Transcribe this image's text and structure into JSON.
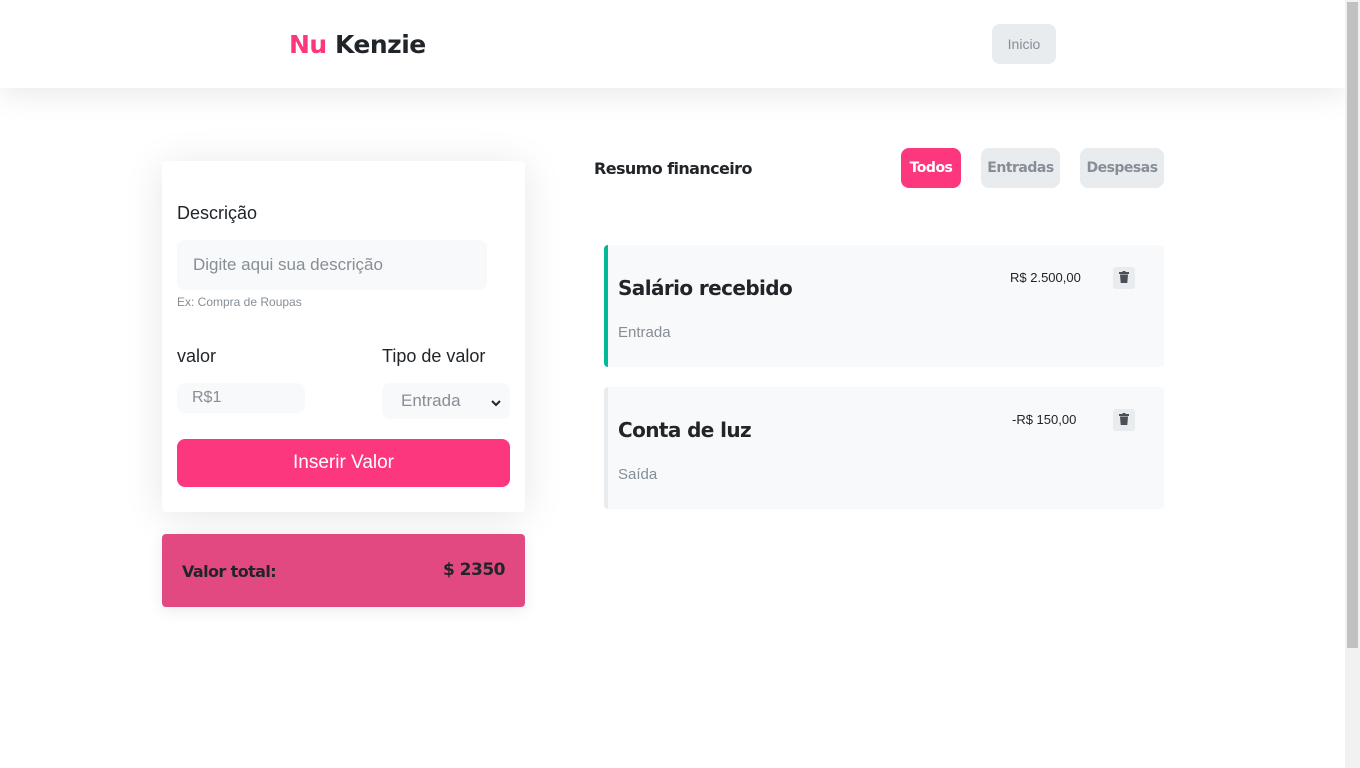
{
  "header": {
    "logo_part1": "Nu",
    "logo_part2": "Kenzie",
    "home_button": "Inicio"
  },
  "form": {
    "description_label": "Descrição",
    "description_placeholder": "Digite aqui sua descrição",
    "description_hint": "Ex: Compra de Roupas",
    "value_label": "valor",
    "value_placeholder": "R$1",
    "type_label": "Tipo de valor",
    "type_selected": "Entrada",
    "submit_label": "Inserir Valor"
  },
  "total": {
    "label": "Valor total:",
    "value": "$ 2350"
  },
  "summary": {
    "title": "Resumo financeiro",
    "filters": [
      {
        "label": "Todos",
        "active": true
      },
      {
        "label": "Entradas",
        "active": false
      },
      {
        "label": "Despesas",
        "active": false
      }
    ]
  },
  "entries": [
    {
      "title": "Salário recebido",
      "type": "Entrada",
      "amount": "R$ 2.500,00",
      "accent": "#03b898"
    },
    {
      "title": "Conta de luz",
      "type": "Saída",
      "amount": "-R$ 150,00",
      "accent": "#e9ecef"
    }
  ],
  "colors": {
    "primary": "#fd377e",
    "total_bg": "#e34981",
    "income_accent": "#03b898",
    "expense_accent": "#e9ecef"
  }
}
